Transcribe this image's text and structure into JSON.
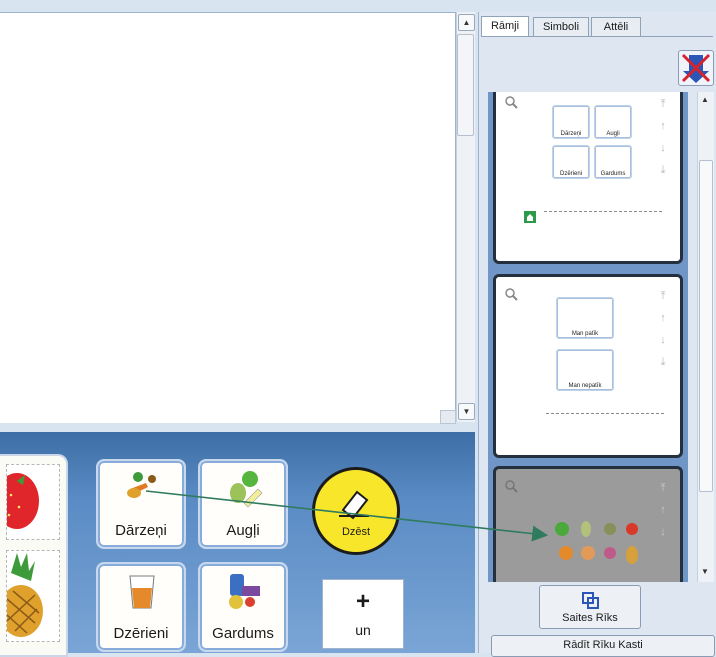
{
  "right_panel": {
    "tabs": [
      {
        "label": "Rāmji",
        "active": true
      },
      {
        "label": "Simboli",
        "active": false
      },
      {
        "label": "Attēli",
        "active": false
      }
    ],
    "download_icon": "download-to-page-icon",
    "thumbnails": [
      {
        "cells": [
          "Dārzeņi",
          "Augļi",
          "Dzērieni",
          "Gardums"
        ],
        "has_home_icon": true
      },
      {
        "cells": [
          "Man patīk",
          "Man nepatīk"
        ]
      },
      {
        "cells": [],
        "selected": true
      }
    ],
    "link_button_label": "Saites Rīks",
    "show_button_label": "Rādīt Rīku Kasti"
  },
  "bottom_panel": {
    "cells": [
      {
        "label": "Dārzeņi",
        "icon": "vegetables-icon"
      },
      {
        "label": "Augļi",
        "icon": "fruit-icon"
      },
      {
        "label": "Dzērieni",
        "icon": "drink-icon"
      },
      {
        "label": "Gardums",
        "icon": "sweets-icon"
      }
    ],
    "erase_label": "Dzēst",
    "plus_symbol": "+",
    "plus_label": "un"
  },
  "colors": {
    "panel_blue": "#5a8bc4",
    "erase_yellow": "#f8e62b",
    "link_green": "#2f7b5e"
  }
}
